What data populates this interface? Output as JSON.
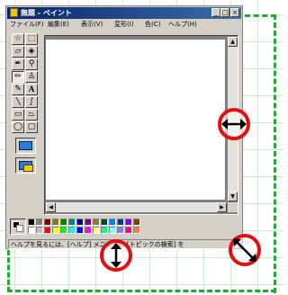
{
  "window": {
    "title": "無題 - ペイント",
    "controls": {
      "minimize": "_",
      "maximize": "□",
      "close": "×"
    },
    "menu": [
      "ファイル(F)",
      "編集(E)",
      "表示(V)",
      "変形(I)",
      "色(C)",
      "ヘルプ(H)"
    ]
  },
  "tools": [
    {
      "name": "free-select-tool",
      "glyph": "☆"
    },
    {
      "name": "rect-select-tool",
      "glyph": "⬚"
    },
    {
      "name": "eraser-tool",
      "glyph": "▱"
    },
    {
      "name": "fill-tool",
      "glyph": "◈"
    },
    {
      "name": "color-picker-tool",
      "glyph": "✒"
    },
    {
      "name": "magnifier-tool",
      "glyph": "⚲"
    },
    {
      "name": "pencil-tool",
      "glyph": "✏"
    },
    {
      "name": "brush-tool",
      "glyph": "♙"
    },
    {
      "name": "airbrush-tool",
      "glyph": "✎"
    },
    {
      "name": "text-tool",
      "glyph": "A"
    },
    {
      "name": "line-tool",
      "glyph": "╲"
    },
    {
      "name": "curve-tool",
      "glyph": "∫"
    },
    {
      "name": "rectangle-tool",
      "glyph": "▭"
    },
    {
      "name": "polygon-tool",
      "glyph": "⏢"
    },
    {
      "name": "ellipse-tool",
      "glyph": "◯"
    },
    {
      "name": "rounded-rect-tool",
      "glyph": "▢"
    }
  ],
  "palette": {
    "foreground": "#000000",
    "background": "#ffffff",
    "colors_top": [
      "#000000",
      "#808080",
      "#800000",
      "#808000",
      "#008000",
      "#008080",
      "#000080",
      "#800080",
      "#808040",
      "#004040",
      "#0080ff",
      "#004080",
      "#8000ff",
      "#804000"
    ],
    "colors_bottom": [
      "#ffffff",
      "#c0c0c0",
      "#ff0000",
      "#ffff00",
      "#00ff00",
      "#00ffff",
      "#0000ff",
      "#ff00ff",
      "#ffff80",
      "#00ff80",
      "#80ffff",
      "#8080ff",
      "#ff0080",
      "#ff8040"
    ]
  },
  "status": {
    "text": "ヘルプを見るには、[ヘルプ] メニューの [トピックの検索] を"
  },
  "annotations": {
    "circles": [
      "horizontal-resize-cursor",
      "vertical-resize-cursor",
      "diagonal-resize-cursor"
    ],
    "highlight_color": "#e01010",
    "dashed_outline_color": "#22aa33"
  }
}
